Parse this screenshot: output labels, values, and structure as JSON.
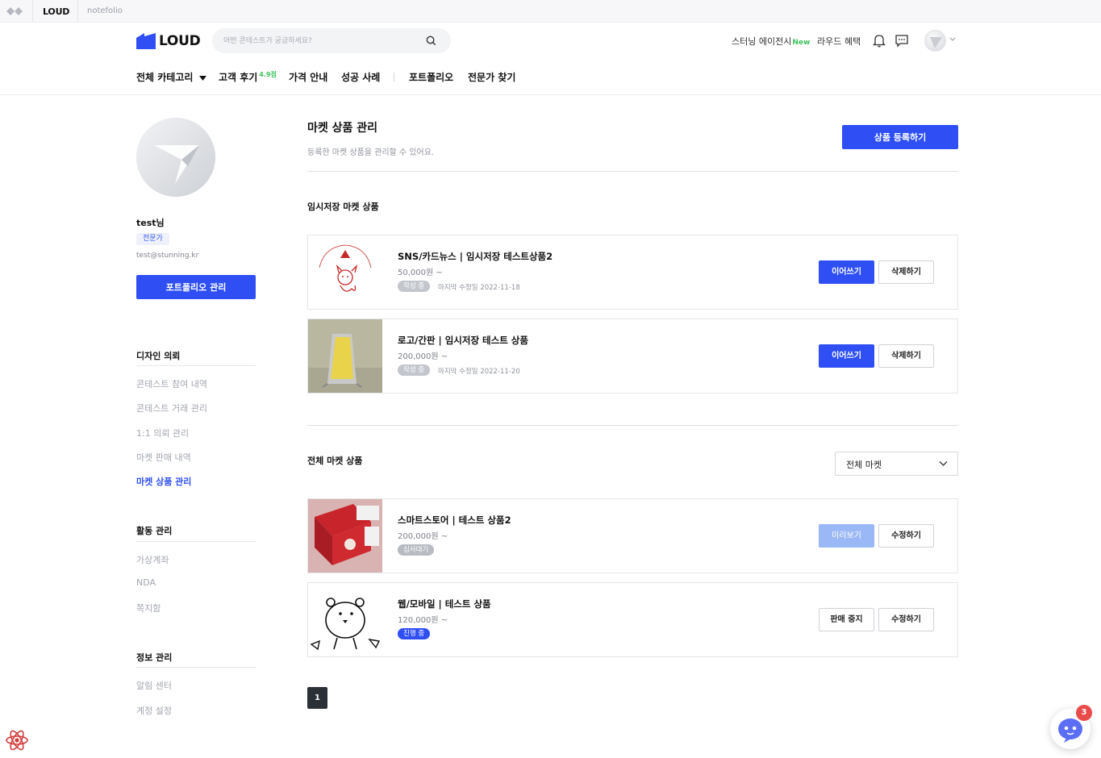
{
  "topbar": {
    "brand": "LOUD",
    "second": "notefolio"
  },
  "header": {
    "logo_text": "LOUD",
    "search_placeholder": "어떤 콘테스트가 궁금하세요?",
    "links": {
      "exhibition": "스터닝 에이전시",
      "exhibition_badge": "New",
      "benefits": "라우드 혜택"
    },
    "icons": [
      "bell-icon",
      "message-icon",
      "avatar",
      "chevron-down-icon"
    ]
  },
  "nav": {
    "category": "전체 카테고리",
    "reviews": "고객 후기",
    "reviews_score": "4.9점",
    "pricing": "가격 안내",
    "cases": "성공 사례",
    "portfolio": "포트폴리오",
    "find_expert": "전문가 찾기"
  },
  "profile": {
    "name": "test님",
    "role": "전문가",
    "email": "test@stunning.kr",
    "portfolio_button": "포트폴리오 관리"
  },
  "sidebar": {
    "design_request": {
      "title": "디자인 의뢰",
      "items": [
        "콘테스트 참여 내역",
        "콘테스트 거래 관리",
        "1:1 의뢰 관리",
        "마켓 판매 내역",
        "마켓 상품 관리"
      ]
    },
    "activity": {
      "title": "활동 관리",
      "items": [
        "가상계좌",
        "NDA",
        "쪽지함"
      ]
    },
    "info": {
      "title": "정보 관리",
      "items": [
        "알림 센터",
        "계정 설정"
      ]
    }
  },
  "main": {
    "title": "마켓 상품 관리",
    "subtitle": "등록한 마켓 상품을 관리할 수 있어요.",
    "register_button": "상품 등록하기",
    "drafts_title": "임시저장 마켓 상품",
    "drafts": [
      {
        "title": "SNS/카드뉴스 | 임시저장 테스트상품2",
        "price": "50,000원 ~",
        "status": "작성 중",
        "date": "마지막 수정일 2022-11-18",
        "btn1": "이어쓰기",
        "btn2": "삭제하기",
        "thumb_text": "NEOFOX24 STUDY CAFE"
      },
      {
        "title": "로고/간판 | 임시저장 테스트 상품",
        "price": "200,000원 ~",
        "status": "작성 중",
        "date": "마지막 수정일 2022-11-20",
        "btn1": "이어쓰기",
        "btn2": "삭제하기"
      }
    ],
    "all_title": "전체 마켓 상품",
    "filter_value": "전체 마켓",
    "products": [
      {
        "title": "스마트스토어 | 테스트 상품2",
        "price": "200,000원 ~",
        "status": "심사대기",
        "btn1": "미리보기",
        "btn2": "수정하기"
      },
      {
        "title": "웹/모바일 | 테스트 상품",
        "price": "120,000원 ~",
        "status": "진행 중",
        "btn1": "판매 중지",
        "btn2": "수정하기"
      }
    ],
    "page": "1"
  },
  "chat": {
    "badge": "3"
  },
  "colors": {
    "primary": "#2f4ff5",
    "accent_green": "#3ec15f",
    "badge_red": "#e94b4b"
  }
}
